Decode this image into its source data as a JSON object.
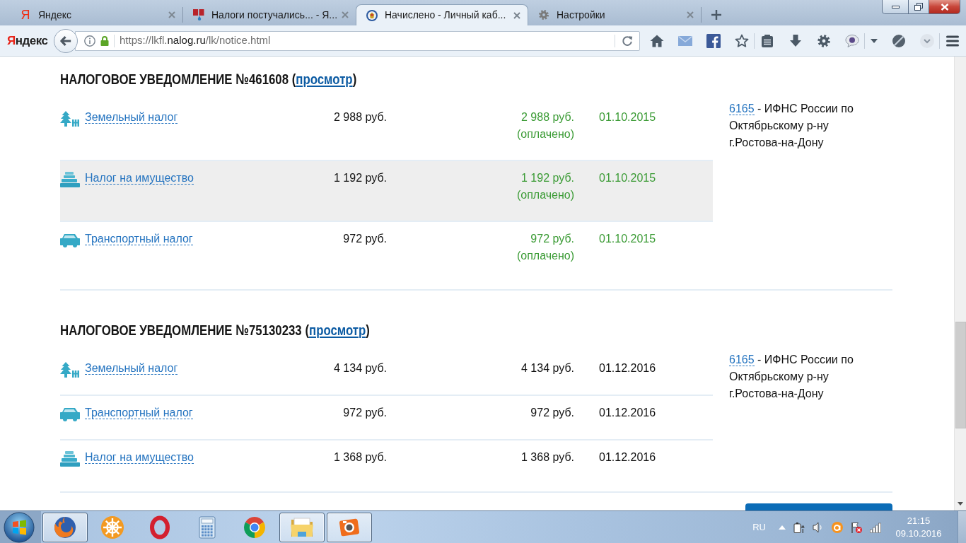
{
  "browser": {
    "tabs": [
      {
        "kind": "letter",
        "glyph": "Я",
        "title": "Яндекс",
        "selected": false
      },
      {
        "kind": "drop",
        "title": "Налоги постучались... - Я...",
        "selected": false
      },
      {
        "kind": "emblem",
        "title": "Начислено - Личный каб...",
        "selected": true
      },
      {
        "kind": "gear",
        "title": "Настройки",
        "selected": false
      }
    ],
    "brand": "Яндекс",
    "url": {
      "start": "https://lkfl.",
      "host": "nalog.ru",
      "end": "/lk/notice.html"
    }
  },
  "notices": [
    {
      "title": "НАЛОГОВОЕ УВЕДОМЛЕНИЕ №461608 (",
      "view_link": "просмотр",
      "title_end": ")",
      "rows": [
        {
          "kind": "land",
          "name": "Земельный налог",
          "amount": "2 988 руб.",
          "paid_amount": "2 988 руб.",
          "paid": true,
          "status": "(оплачено)",
          "date": "01.10.2015",
          "highlighted": false
        },
        {
          "kind": "property",
          "name": "Налог на имущество",
          "amount": "1 192 руб.",
          "paid_amount": "1 192 руб.",
          "paid": true,
          "status": "(оплачено)",
          "date": "01.10.2015",
          "highlighted": true
        },
        {
          "kind": "transport",
          "name": "Транспортный налог",
          "amount": "972 руб.",
          "paid_amount": "972 руб.",
          "paid": true,
          "status": "(оплачено)",
          "date": "01.10.2015",
          "highlighted": false
        }
      ],
      "inspection": {
        "code": "6165",
        "text": "- ИФНС России по Октябрьскому р-ну г.Ростова-на-Дону"
      }
    },
    {
      "title": "НАЛОГОВОЕ УВЕДОМЛЕНИЕ №75130233 (",
      "view_link": "просмотр",
      "title_end": ")",
      "rows": [
        {
          "kind": "land",
          "name": "Земельный налог",
          "amount": "4 134 руб.",
          "paid_amount": "4 134 руб.",
          "paid": false,
          "date": "01.12.2016",
          "highlighted": false
        },
        {
          "kind": "transport",
          "name": "Транспортный налог",
          "amount": "972 руб.",
          "paid_amount": "972 руб.",
          "paid": false,
          "date": "01.12.2016",
          "highlighted": false
        },
        {
          "kind": "property",
          "name": "Налог на имущество",
          "amount": "1 368 руб.",
          "paid_amount": "1 368 руб.",
          "paid": false,
          "date": "01.12.2016",
          "highlighted": false
        }
      ],
      "inspection": {
        "code": "6165",
        "text": "- ИФНС России по Октябрьскому р-ну г.Ростова-на-Дону"
      }
    }
  ],
  "taskbar": {
    "apps": [
      {
        "kind": "firefox",
        "running": true
      },
      {
        "kind": "helm",
        "running": false
      },
      {
        "kind": "opera",
        "running": false
      },
      {
        "kind": "calculator",
        "running": false
      },
      {
        "kind": "chrome",
        "running": false
      },
      {
        "kind": "folder",
        "running": true
      },
      {
        "kind": "camera",
        "running": true
      }
    ],
    "language": "RU",
    "time": "21:15",
    "date": "09.10.2016"
  }
}
